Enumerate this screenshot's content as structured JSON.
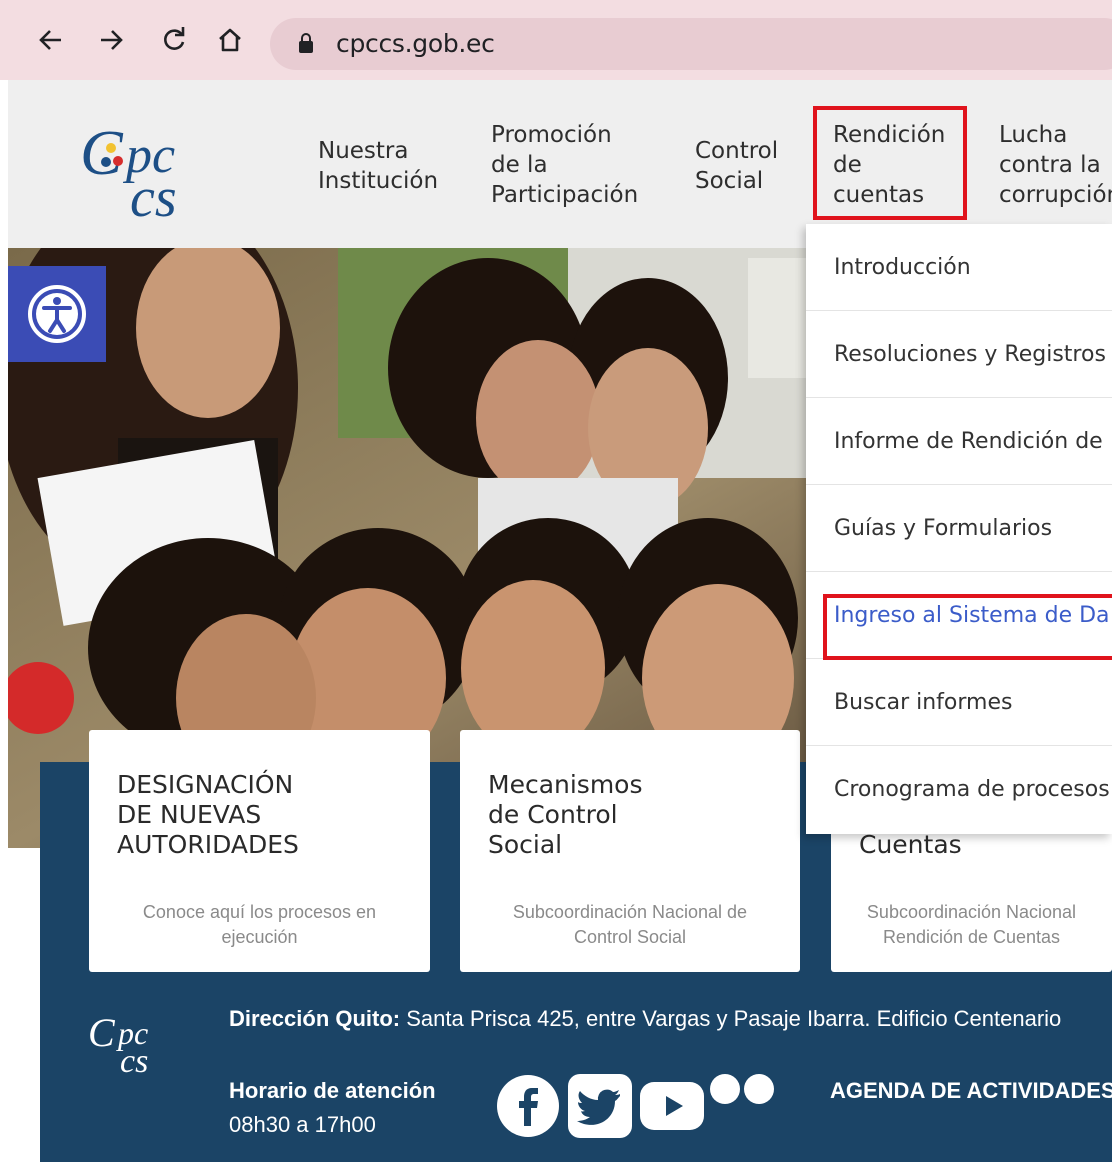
{
  "browser": {
    "url": "cpccs.gob.ec",
    "back_icon": "arrow-left-icon",
    "forward_icon": "arrow-right-icon",
    "reload_icon": "reload-icon",
    "home_icon": "home-icon"
  },
  "header": {
    "nav": [
      {
        "label": "Nuestra\nInstitución"
      },
      {
        "label": "Promoción\nde la\nParticipación"
      },
      {
        "label": "Control\nSocial"
      },
      {
        "label": "Rendición\nde\ncuentas"
      },
      {
        "label": "Lucha\ncontra la\ncorrupción"
      }
    ]
  },
  "dropdown": {
    "items": [
      {
        "label": "Introducción"
      },
      {
        "label": "Resoluciones y Registros"
      },
      {
        "label": "Informe de Rendición de"
      },
      {
        "label": "Guías y Formularios"
      },
      {
        "label": "Ingreso al Sistema de Da"
      },
      {
        "label": "Buscar informes"
      },
      {
        "label": "Cronograma de procesos"
      }
    ],
    "active_index": 4
  },
  "cards": [
    {
      "title": "DESIGNACIÓN\nDE NUEVAS\nAUTORIDADES",
      "subtitle": "Conoce aquí los procesos en\nejecución"
    },
    {
      "title": "Mecanismos\nde Control\nSocial",
      "subtitle": "Subcoordinación Nacional de\nControl Social"
    },
    {
      "title": "Cuentas",
      "subtitle": "Subcoordinación Nacional\nRendición de Cuentas"
    }
  ],
  "footer": {
    "address_label": "Dirección Quito:",
    "address_text": " Santa Prisca 425, entre Vargas y Pasaje Ibarra. Edificio Centenario",
    "hours_label": "Horario de atención",
    "hours_value": "08h30 a 17h00",
    "agenda_label": "AGENDA DE ACTIVIDADES"
  },
  "colors": {
    "highlight": "#e0131c",
    "band": "#1b4466",
    "accessibility": "#3b4cb5",
    "active_link": "#3b5cc9"
  }
}
